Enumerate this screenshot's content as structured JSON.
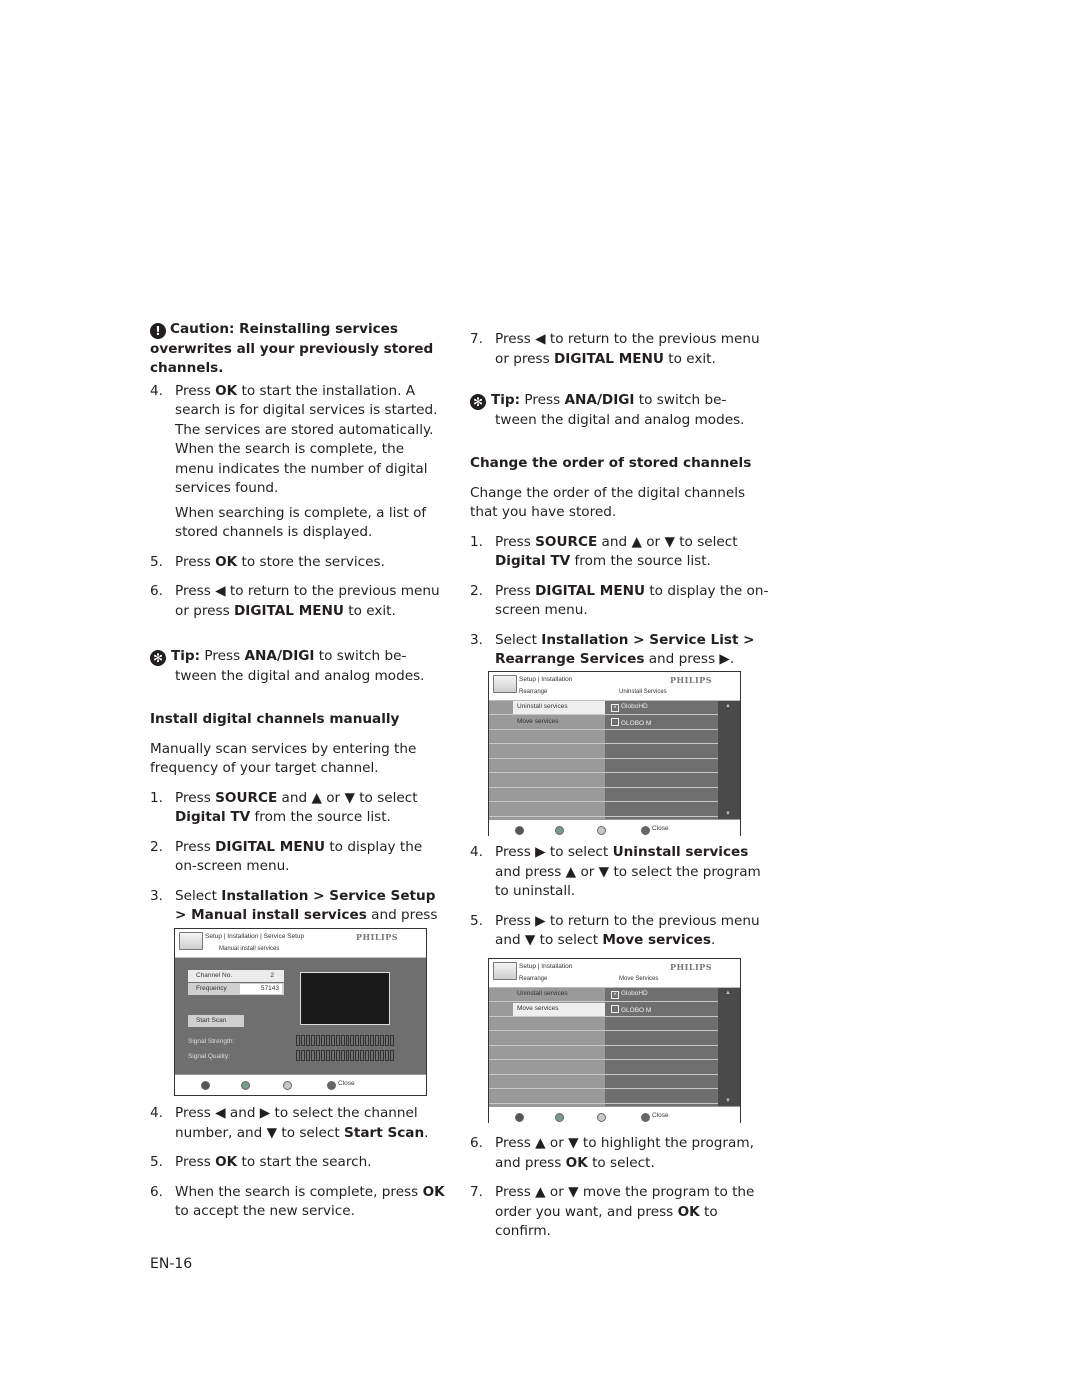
{
  "left_column": {
    "caution": {
      "icon": "exclamation-icon",
      "text": "Caution: Reinstalling services overwrites all your previously stored channels."
    },
    "steps_a": [
      {
        "num": "4.",
        "parts": [
          "Press ",
          "OK",
          " to start the installation. A search is for digital services is started. The services are stored automatically. When the search is complete, the menu indicates the number of digital services found."
        ],
        "extra": "When searching is complete, a list of stored channels is displayed."
      },
      {
        "num": "5.",
        "parts": [
          "Press ",
          "OK",
          " to store the services."
        ]
      },
      {
        "num": "6.",
        "parts": [
          "Press ◀ to return to the previous menu or press ",
          "DIGITAL MENU",
          " to exit."
        ]
      }
    ],
    "tip": {
      "icon": "tip-flower-icon",
      "label": "Tip:",
      "text_pre": " Press ",
      "key": "ANA/DIGI",
      "text_post": " to switch be- tween the digital and analog modes."
    },
    "section_title": "Install digital channels manually",
    "intro": "Manually scan services by entering the frequency of your target channel.",
    "steps_b": [
      {
        "num": "1.",
        "parts": [
          "Press ",
          "SOURCE",
          " and ▲ or ▼ to select ",
          "Digital TV",
          " from the source list."
        ]
      },
      {
        "num": "2.",
        "parts": [
          "Press ",
          "DIGITAL MENU",
          " to display the on-screen menu."
        ]
      },
      {
        "num": "3.",
        "parts": [
          "Select ",
          "Installation > Service Setup > Manual install services",
          " and press ▶."
        ]
      }
    ],
    "steps_c": [
      {
        "num": "4.",
        "parts": [
          "Press ◀ and ▶ to select the channel number, and ▼ to select ",
          "Start Scan",
          "."
        ]
      },
      {
        "num": "5.",
        "parts": [
          "Press ",
          "OK",
          " to start the search."
        ]
      },
      {
        "num": "6.",
        "parts": [
          "When the search is complete, press ",
          "OK",
          " to accept the new service."
        ]
      }
    ]
  },
  "screen_manual": {
    "breadcrumb": "Setup  |  Installation | Service Setup",
    "subtitle": "Manual install services",
    "brand": "PHILIPS",
    "channel_label": "Channel No.",
    "channel_value": "2",
    "frequency_label": "Frequency",
    "frequency_value": "57143",
    "start_scan": "Start Scan",
    "signal_strength": "Signal Strength:",
    "signal_quality": "Signal Quality:",
    "footer_close": "Close",
    "footer_dot_colors": [
      "#555555",
      "#7a9a8a",
      "#c8c8c8",
      "#666666"
    ]
  },
  "right_column": {
    "steps_a": [
      {
        "num": "7.",
        "parts": [
          "Press ◀ to return to the previous menu or press ",
          "DIGITAL MENU",
          " to exit."
        ]
      }
    ],
    "tip": {
      "icon": "tip-flower-icon",
      "label": "Tip:",
      "text_pre": " Press ",
      "key": "ANA/DIGI",
      "text_post": " to switch be- tween the digital and analog modes."
    },
    "section_title": "Change the order of stored channels",
    "intro": "Change the order of the digital channels that you have stored.",
    "steps_b": [
      {
        "num": "1.",
        "parts": [
          "Press ",
          "SOURCE",
          " and ▲ or ▼ to select ",
          "Digital TV",
          " from the source list."
        ]
      },
      {
        "num": "2.",
        "parts": [
          "Press ",
          "DIGITAL MENU",
          " to display the on-screen menu."
        ]
      },
      {
        "num": "3.",
        "parts": [
          "Select ",
          "Installation > Service List > Rearrange Services",
          " and press ▶."
        ]
      }
    ],
    "steps_c": [
      {
        "num": "4.",
        "parts": [
          "Press ▶ to select ",
          "Uninstall services",
          " and press ▲ or ▼ to select the program to uninstall."
        ]
      },
      {
        "num": "5.",
        "parts": [
          "Press ▶ to return to the previous menu and ▼ to select ",
          "Move services",
          "."
        ]
      }
    ],
    "steps_d": [
      {
        "num": "6.",
        "parts": [
          "Press ▲ or ▼ to highlight the program, and press ",
          "OK",
          " to select."
        ]
      },
      {
        "num": "7.",
        "parts": [
          "Press ▲ or ▼ move the program to the order you want, and press ",
          "OK",
          " to confirm."
        ]
      }
    ]
  },
  "screen_uninstall": {
    "breadcrumb": "Setup | Installation",
    "brand": "PHILIPS",
    "left_header": "Rearrange",
    "right_header": "Uninstall Services",
    "menu_items": [
      "Uninstall services",
      "Move services"
    ],
    "selected_index": 0,
    "channels": [
      {
        "name": "GloboHD",
        "checked": true
      },
      {
        "name": "GLOBO M",
        "checked": false
      }
    ],
    "footer_close": "Close"
  },
  "screen_move": {
    "breadcrumb": "Setup | Installation",
    "brand": "PHILIPS",
    "left_header": "Rearrange",
    "right_header": "Move Services",
    "menu_items": [
      "Uninstall services",
      "Move services"
    ],
    "selected_index": 1,
    "channels": [
      {
        "name": "GloboHD",
        "checked": true
      },
      {
        "name": "GLOBO M",
        "checked": false
      }
    ],
    "footer_close": "Close"
  },
  "page_number": "EN-16"
}
